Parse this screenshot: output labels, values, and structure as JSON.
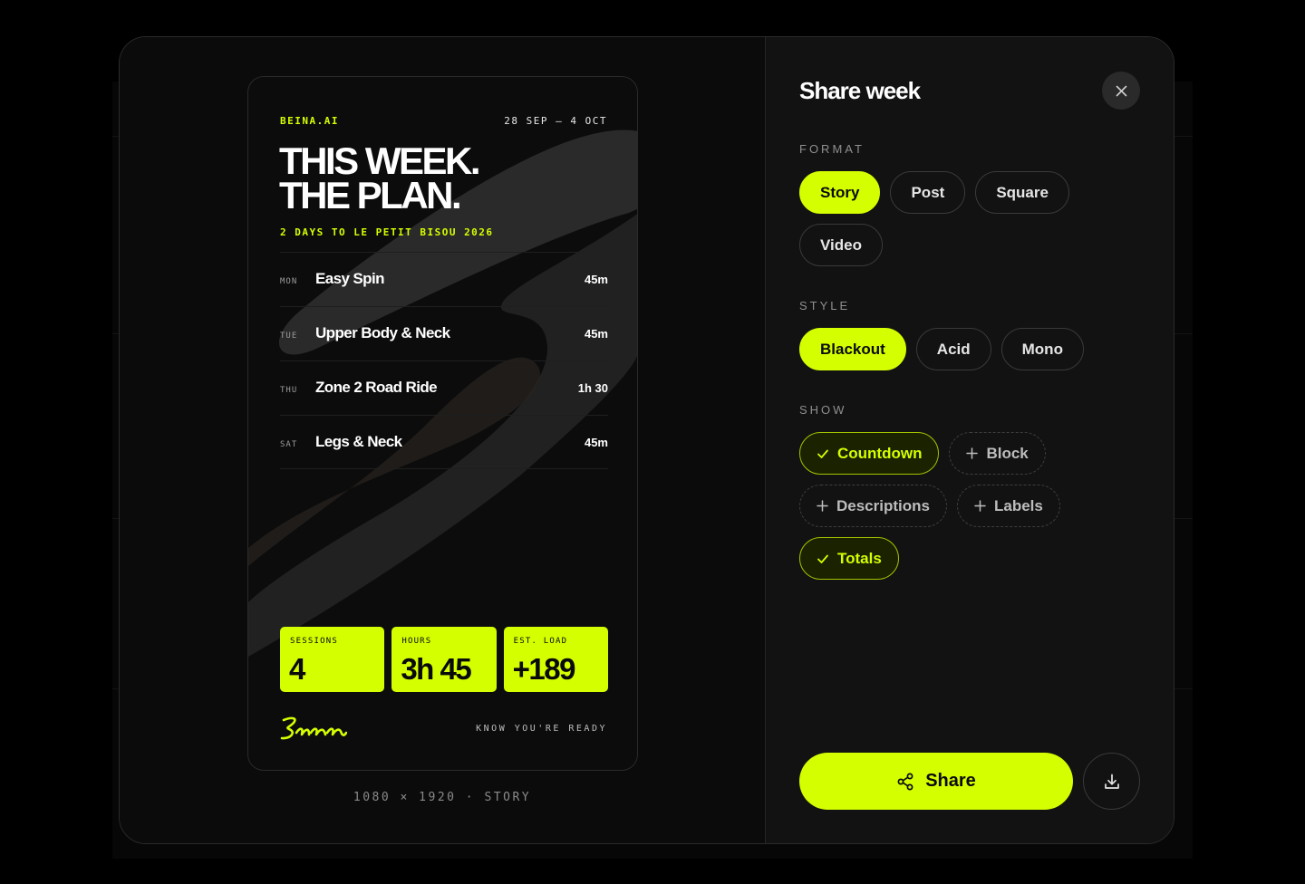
{
  "dialog": {
    "title": "Share week",
    "close_icon": "close-icon"
  },
  "card": {
    "brand": "BEINA.AI",
    "date_range": "28 SEP – 4 OCT",
    "headline_1": "THIS WEEK.",
    "headline_2": "THE PLAN.",
    "countdown": "2 DAYS TO LE PETIT BISOU 2026",
    "sessions": [
      {
        "day": "MON",
        "name": "Easy Spin",
        "duration": "45m"
      },
      {
        "day": "TUE",
        "name": "Upper Body & Neck",
        "duration": "45m"
      },
      {
        "day": "THU",
        "name": "Zone 2 Road Ride",
        "duration": "1h 30"
      },
      {
        "day": "SAT",
        "name": "Legs & Neck",
        "duration": "45m"
      }
    ],
    "stats": [
      {
        "label": "SESSIONS",
        "value": "4"
      },
      {
        "label": "HOURS",
        "value": "3h 45"
      },
      {
        "label": "EST. LOAD",
        "value": "+189"
      }
    ],
    "logo_icon": "script-logo-icon",
    "tagline": "KNOW YOU'RE READY",
    "accent_color": "#d4ff00"
  },
  "preview_meta": "1080 × 1920 · STORY",
  "format": {
    "label": "FORMAT",
    "options": [
      "Story",
      "Post",
      "Square",
      "Video"
    ],
    "selected": "Story"
  },
  "style": {
    "label": "STYLE",
    "options": [
      "Blackout",
      "Acid",
      "Mono"
    ],
    "selected": "Blackout"
  },
  "show": {
    "label": "SHOW",
    "toggles": [
      {
        "label": "Countdown",
        "on": true
      },
      {
        "label": "Block",
        "on": false
      },
      {
        "label": "Descriptions",
        "on": false
      },
      {
        "label": "Labels",
        "on": false
      },
      {
        "label": "Totals",
        "on": true
      }
    ]
  },
  "actions": {
    "share_label": "Share",
    "share_icon": "share-icon",
    "download_icon": "download-icon"
  }
}
